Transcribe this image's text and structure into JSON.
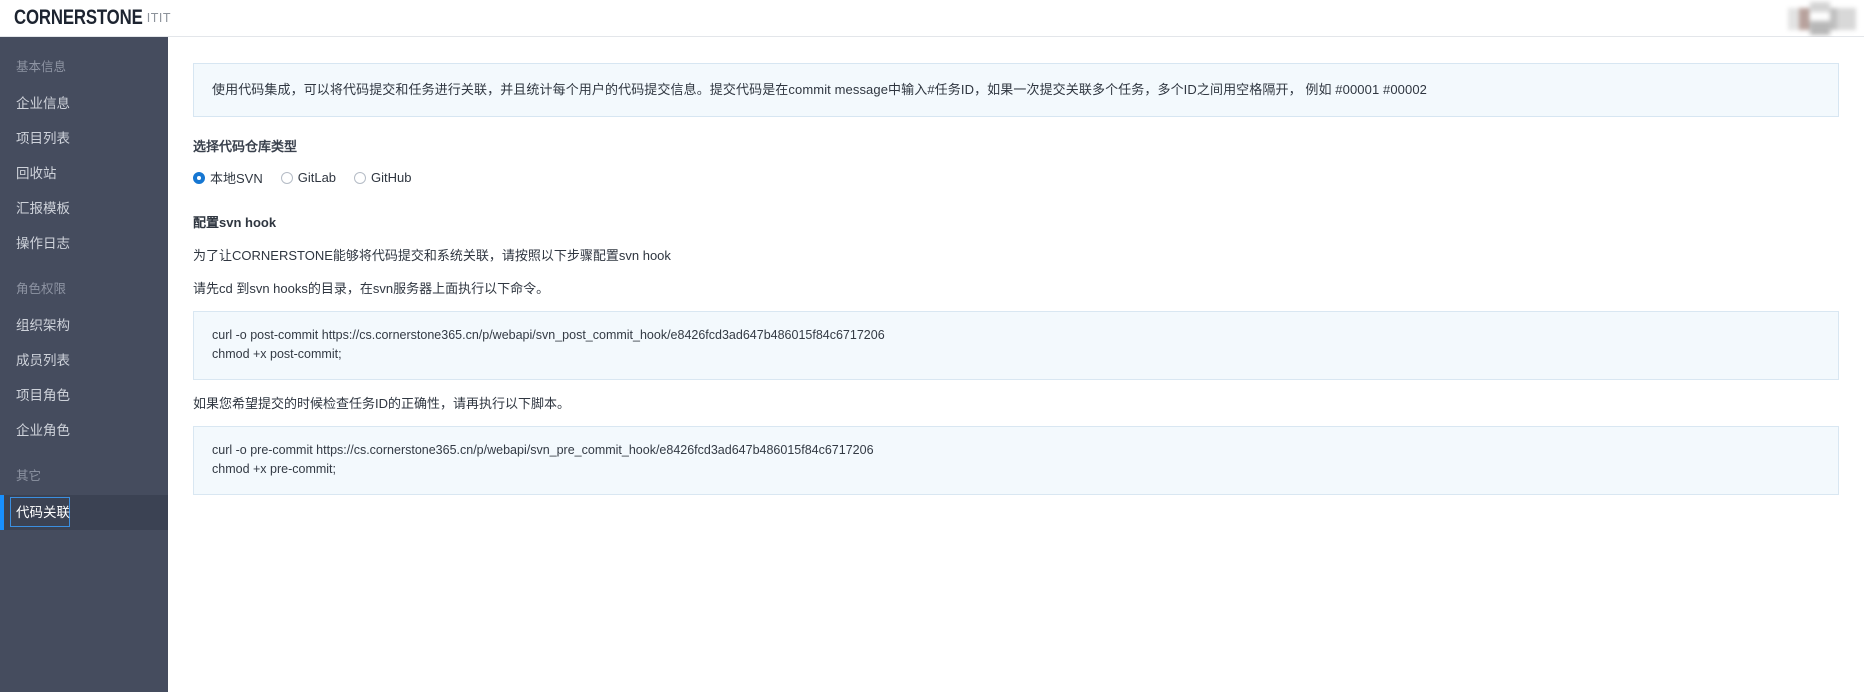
{
  "topbar": {
    "brand": "CORNERSTONE",
    "org": "ITIT",
    "avatar_name": "avatar-redacted"
  },
  "sidebar": {
    "groups": [
      {
        "title": "基本信息",
        "items": [
          {
            "label": "企业信息",
            "active": false
          },
          {
            "label": "项目列表",
            "active": false
          },
          {
            "label": "回收站",
            "active": false
          },
          {
            "label": "汇报模板",
            "active": false
          },
          {
            "label": "操作日志",
            "active": false
          }
        ]
      },
      {
        "title": "角色权限",
        "items": [
          {
            "label": "组织架构",
            "active": false
          },
          {
            "label": "成员列表",
            "active": false
          },
          {
            "label": "项目角色",
            "active": false
          },
          {
            "label": "企业角色",
            "active": false
          }
        ]
      },
      {
        "title": "其它",
        "items": [
          {
            "label": "代码关联",
            "active": true
          }
        ]
      }
    ]
  },
  "main": {
    "notice": "使用代码集成，可以将代码提交和任务进行关联，并且统计每个用户的代码提交信息。提交代码是在commit message中输入#任务ID，如果一次提交关联多个任务，多个ID之间用空格隔开， 例如 #00001 #00002",
    "repo_type_label": "选择代码仓库类型",
    "repo_options": [
      {
        "label": "本地SVN",
        "checked": true
      },
      {
        "label": "GitLab",
        "checked": false
      },
      {
        "label": "GitHub",
        "checked": false
      }
    ],
    "hook_title": "配置svn hook",
    "hook_desc": "为了让CORNERSTONE能够将代码提交和系统关联，请按照以下步骤配置svn hook",
    "post_commit_intro": "请先cd 到svn hooks的目录，在svn服务器上面执行以下命令。",
    "post_commit_code": [
      "curl -o post-commit https://cs.cornerstone365.cn/p/webapi/svn_post_commit_hook/e8426fcd3ad647b486015f84c6717206",
      "chmod +x post-commit;"
    ],
    "pre_commit_intro": "如果您希望提交的时候检查任务ID的正确性，请再执行以下脚本。",
    "pre_commit_code": [
      "curl -o pre-commit https://cs.cornerstone365.cn/p/webapi/svn_pre_commit_hook/e8426fcd3ad647b486015f84c6717206",
      "chmod +x pre-commit;"
    ]
  },
  "colors": {
    "sidebar_bg": "#454c5e",
    "sidebar_active_bg": "#3b4253",
    "accent": "#1890ff",
    "notice_bg": "#f3f9fd",
    "notice_border": "#d7e6f2"
  }
}
